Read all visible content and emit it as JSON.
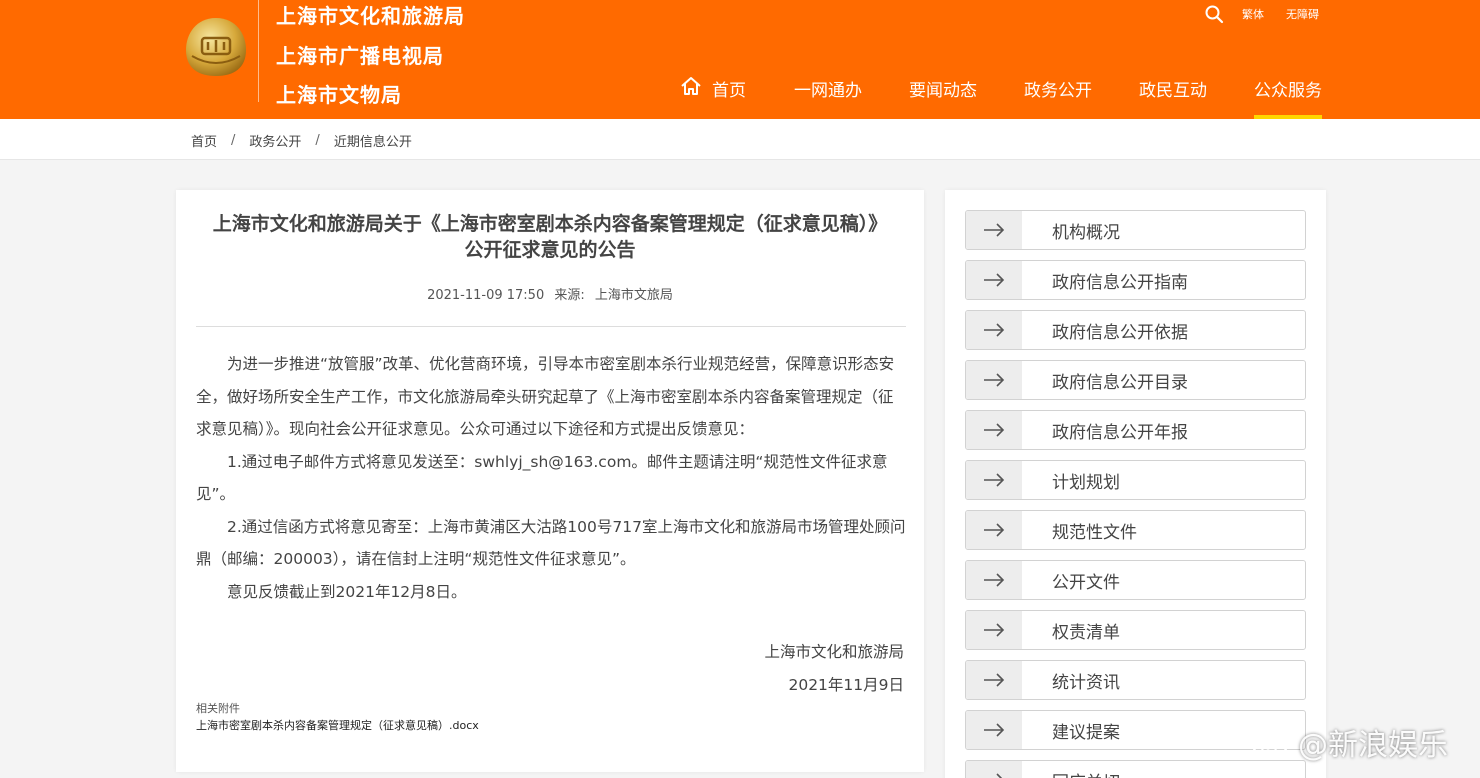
{
  "header": {
    "org_names": [
      "上海市文化和旅游局",
      "上海市广播电视局",
      "上海市文物局"
    ],
    "tools": [
      "繁体",
      "无障碍"
    ],
    "nav": [
      "首页",
      "一网通办",
      "要闻动态",
      "政务公开",
      "政民互动",
      "公众服务"
    ],
    "active_nav": "公众服务",
    "accent_color": "#ff6a00",
    "active_underline_color": "#ffd600"
  },
  "breadcrumb": [
    "首页",
    "政务公开",
    "近期信息公开"
  ],
  "article": {
    "title": "上海市文化和旅游局关于《上海市密室剧本杀内容备案管理规定（征求意见稿）》公开征求意见的公告",
    "datetime": "2021-11-09 17:50",
    "source_label": "来源:",
    "source": "上海市文旅局",
    "paragraphs": [
      "为进一步推进“放管服”改革、优化营商环境，引导本市密室剧本杀行业规范经营，保障意识形态安全，做好场所安全生产工作，市文化旅游局牵头研究起草了《上海市密室剧本杀内容备案管理规定（征求意见稿）》。现向社会公开征求意见。公众可通过以下途径和方式提出反馈意见：",
      "1.通过电子邮件方式将意见发送至：swhlyj_sh@163.com。邮件主题请注明“规范性文件征求意见”。",
      "2.通过信函方式将意见寄至：上海市黄浦区大沽路100号717室上海市文化和旅游局市场管理处顾问鼎（邮编：200003），请在信封上注明“规范性文件征求意见”。",
      "意见反馈截止到2021年12月8日。"
    ],
    "signature": "上海市文化和旅游局",
    "sign_date": "2021年11月9日",
    "attachment_label": "相关附件",
    "attachment_file": "上海市密室剧本杀内容备案管理规定（征求意见稿）.docx"
  },
  "sidebar": {
    "items": [
      "机构概况",
      "政府信息公开指南",
      "政府信息公开依据",
      "政府信息公开目录",
      "政府信息公开年报",
      "计划规划",
      "规范性文件",
      "公开文件",
      "权责清单",
      "统计资讯",
      "建议提案",
      "回应关切"
    ]
  },
  "watermark": "@新浪娱乐",
  "icons": {
    "search": "search-icon",
    "home": "home-icon",
    "arrow": "arrow-right-icon",
    "logo": "emblem-logo",
    "weibo": "weibo-logo"
  }
}
